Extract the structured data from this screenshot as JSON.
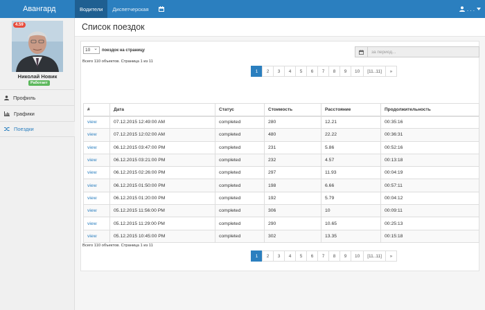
{
  "navbar": {
    "brand": "Авангард",
    "tabs": [
      {
        "label": "Водители"
      },
      {
        "label": "Диспетчерская"
      }
    ],
    "user_label": ". . ."
  },
  "sidebar": {
    "rating": "4.59",
    "driver_name": "Николай Новик",
    "status": "Работает",
    "menu": [
      {
        "label": "Профиль"
      },
      {
        "label": "Графики"
      },
      {
        "label": "Поездки"
      }
    ]
  },
  "main": {
    "title": "Список поездок",
    "per_page_value": "10",
    "per_page_label": "поездок на страницу",
    "period_placeholder": "за период...",
    "summary_top": "Всего 110 объектов. Страница 1 из 11",
    "summary_bottom": "Всего 110 объектов. Страница 1 из 11",
    "pagination": [
      "1",
      "2",
      "3",
      "4",
      "5",
      "6",
      "7",
      "8",
      "9",
      "10",
      "[11..11]",
      "»"
    ],
    "columns": [
      "#",
      "Дата",
      "Статус",
      "Стоимость",
      "Расстояние",
      "Продолжительность"
    ],
    "rows": [
      {
        "link": "view",
        "date": "07.12.2015 12:49:00 AM",
        "status": "completed",
        "cost": "280",
        "distance": "12.21",
        "duration": "00:35:16"
      },
      {
        "link": "view",
        "date": "07.12.2015 12:02:00 AM",
        "status": "completed",
        "cost": "480",
        "distance": "22.22",
        "duration": "00:36:31"
      },
      {
        "link": "view",
        "date": "06.12.2015 03:47:00 PM",
        "status": "completed",
        "cost": "231",
        "distance": "5.86",
        "duration": "00:52:16"
      },
      {
        "link": "view",
        "date": "06.12.2015 03:21:00 PM",
        "status": "completed",
        "cost": "232",
        "distance": "4.57",
        "duration": "00:13:18"
      },
      {
        "link": "view",
        "date": "06.12.2015 02:26:00 PM",
        "status": "completed",
        "cost": "297",
        "distance": "11.93",
        "duration": "00:04:19"
      },
      {
        "link": "view",
        "date": "06.12.2015 01:50:00 PM",
        "status": "completed",
        "cost": "198",
        "distance": "6.66",
        "duration": "00:57:11"
      },
      {
        "link": "view",
        "date": "06.12.2015 01:20:00 PM",
        "status": "completed",
        "cost": "192",
        "distance": "5.79",
        "duration": "00:04:12"
      },
      {
        "link": "view",
        "date": "05.12.2015 11:56:00 PM",
        "status": "completed",
        "cost": "306",
        "distance": "10",
        "duration": "00:09:11"
      },
      {
        "link": "view",
        "date": "05.12.2015 11:29:00 PM",
        "status": "completed",
        "cost": "290",
        "distance": "10.65",
        "duration": "00:25:13"
      },
      {
        "link": "view",
        "date": "05.12.2015 10:45:00 PM",
        "status": "completed",
        "cost": "302",
        "distance": "13.35",
        "duration": "00:15:18"
      }
    ]
  },
  "colors": {
    "navbar": "#2b7fbf",
    "navbar_active": "#1f5f91",
    "rating_badge": "#e74c3c",
    "status_badge": "#5cb85c",
    "link": "#2b7fbf"
  }
}
